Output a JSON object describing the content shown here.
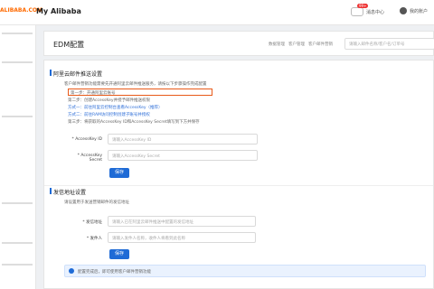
{
  "header": {
    "logo": "ALIBABA.COM",
    "title": "My Alibaba",
    "message_label": "消息中心",
    "message_badge": "99+",
    "user_label": "我的账户"
  },
  "page": {
    "title": "EDM配置",
    "breadcrumbs": [
      "数据管理",
      "客户管理",
      "客户邮件营销"
    ],
    "search_placeholder": "请输入邮件名称/客户名/订单号"
  },
  "section1": {
    "title": "阿里云邮件推送设置",
    "intro": "客户邮件营销功能需要先开通阿里云邮件推送服务，请按以下步骤操作完成配置",
    "step1": "第一步：开通阿里云账号",
    "step2": "第二步：创建AccessKey并授予邮件推送权限",
    "link1": "方式一：前往阿里云控制台查看AccessKey（推荐）",
    "link2": "方式二：前往RAM访问控制创建子账号并授权",
    "step3": "第三步：将获取的AccessKey ID和AccessKey Secret填写到下方并保存",
    "field1_label": "* AccessKey ID",
    "field1_placeholder": "请输入AccessKey ID",
    "field2_label": "* AccessKey Secret",
    "field2_placeholder": "请输入AccessKey Secret",
    "save": "保存"
  },
  "section2": {
    "title": "发信地址设置",
    "desc": "请设置用于发送营销邮件的发信地址",
    "field1_label": "* 发信地址",
    "field1_placeholder": "请输入已在阿里云邮件推送中配置的发信地址",
    "field2_label": "* 发件人",
    "field2_placeholder": "请输入发件人名称，收件人将看到此名称",
    "save": "保存"
  },
  "notice": {
    "text": "配置完成后，即可使用客户邮件营销功能"
  }
}
